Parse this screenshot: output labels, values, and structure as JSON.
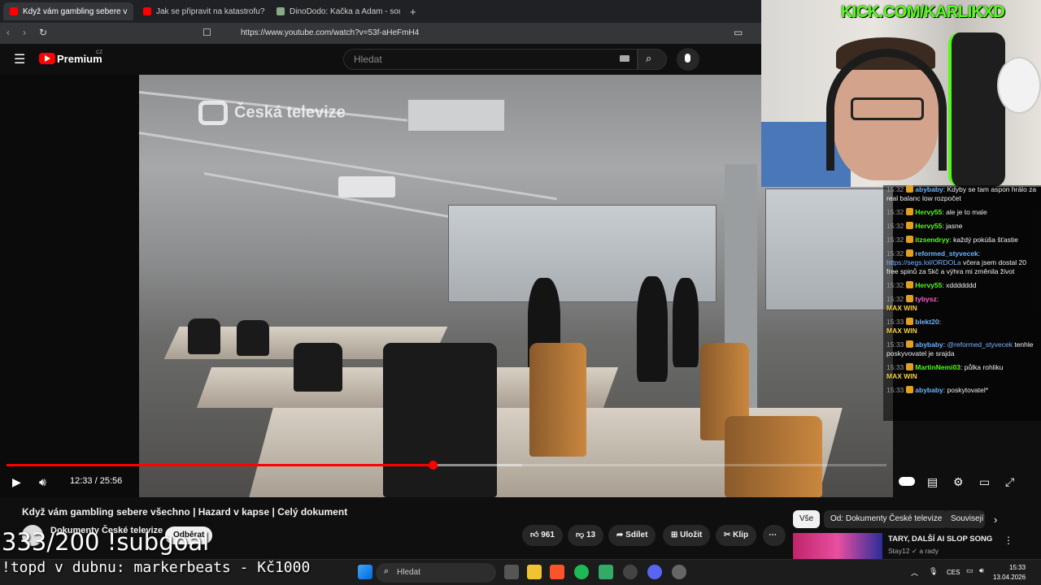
{
  "browser": {
    "tabs": [
      {
        "label": "Když vám gambling sebere v",
        "active": true
      },
      {
        "label": "Jak se připravit na katastrofu? | What",
        "active": false
      },
      {
        "label": "DinoDodo: Kačka a Adam - sourozen",
        "active": false
      }
    ],
    "new_tab": "+",
    "url": "https://www.youtube.com/watch?v=53f-aHeFmH4"
  },
  "youtube": {
    "logo": "Premium",
    "logo_region": "CZ",
    "search_placeholder": "Hledat"
  },
  "video": {
    "watermark": "Česká televize",
    "time_current": "12:33",
    "time_sep": " / ",
    "time_total": "25:56",
    "progress": 0.4839,
    "buffered": 0.586
  },
  "meta": {
    "title": "Když vám gambling sebere všechno | Hazard v kapse | Celý dokument",
    "channel": "Dokumenty České televize",
    "subscribe_label": "Odběrat",
    "likes": "961",
    "dislikes": "13",
    "share": "Sdílet",
    "save": "Uložit",
    "clip": "Klip",
    "more": "⋯"
  },
  "chips": [
    {
      "label": "Vše",
      "active": true
    },
    {
      "label": "Od: Dokumenty České televize",
      "active": false
    },
    {
      "label": "Souvisejí",
      "active": false
    }
  ],
  "recommendation": {
    "title": "TARY, DALŠÍ AI SLOP SONG",
    "channel": "Stay12",
    "channel_suffix": "a rady"
  },
  "stream": {
    "kick": "KICK.COM/KARLIKXD",
    "subgoal": "333/200 !subgoal",
    "topd": "!topd v dubnu: markerbeats - Kč1000"
  },
  "chat": [
    {
      "ts": "15:32",
      "user": "abybaby",
      "color": "#6cb4ff",
      "text": "Kdyby se tam aspon hrálo za real balanc",
      "extra": "low rozpočet"
    },
    {
      "ts": "15:32",
      "user": "Hervy55",
      "color": "#53fc18",
      "text": "ale je to male"
    },
    {
      "ts": "15:32",
      "user": "Hervy55",
      "color": "#53fc18",
      "text": "jasne"
    },
    {
      "ts": "15:32",
      "user": "itzsendryy",
      "color": "#53fc18",
      "text": "každý pokúša šťastie"
    },
    {
      "ts": "15:32",
      "user": "reformed_styvecek",
      "color": "#6cb4ff",
      "link": "https://segs.lol/ORDOLa",
      "text": "včera jsem dostal 20 free spinů za 5kč a výhra mi změnila život"
    },
    {
      "ts": "15:32",
      "user": "Hervy55",
      "color": "#53fc18",
      "text": "xddddddd"
    },
    {
      "ts": "15:32",
      "user": "tybysz",
      "color": "#ff5fd2",
      "text": "",
      "maxwin": "MAX WIN"
    },
    {
      "ts": "15:33",
      "user": "blekt20",
      "color": "#6cb4ff",
      "text": "",
      "maxwin": "MAX WIN"
    },
    {
      "ts": "15:33",
      "user": "abybaby",
      "color": "#6cb4ff",
      "mention": "@reformed_styvecek",
      "text": "tenhle poskyvovatel je srajda"
    },
    {
      "ts": "15:33",
      "user": "MartinNemi03",
      "color": "#53fc18",
      "text": "půlka rohliku",
      "maxwin": "MAX WIN"
    },
    {
      "ts": "15:33",
      "user": "abybaby",
      "color": "#6cb4ff",
      "text": "poskytovatel*"
    }
  ],
  "taskbar": {
    "search": "Hledat",
    "lang": "CES",
    "time": "15:33",
    "date": "13.04.2026"
  },
  "colors": {
    "accent": "#ff0000",
    "kick": "#53fc18"
  }
}
